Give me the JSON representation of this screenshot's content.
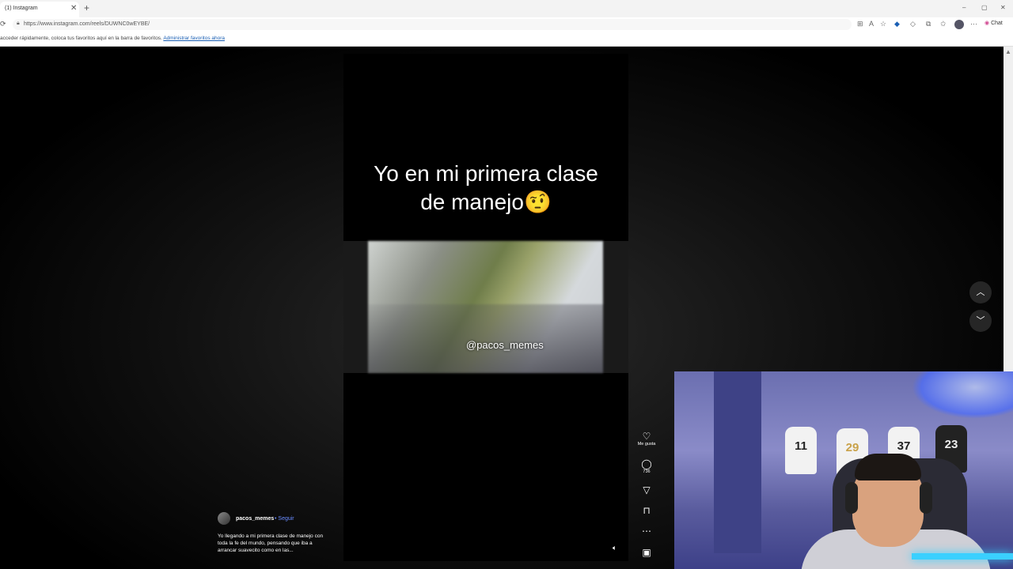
{
  "browser": {
    "tab_title": "(1) Instagram",
    "tab_close": "✕",
    "new_tab": "+",
    "url": "https://www.instagram.com/reels/DUWNC0wEYBE/",
    "copilot_label": "Chat",
    "favorites_text": "acceder rápidamente, coloca tus favoritos aquí en la barra de favoritos.",
    "favorites_link": "Administrar favoritos ahora",
    "window_controls": [
      "–",
      "▢",
      "✕"
    ]
  },
  "reel": {
    "caption_line1": "Yo en mi primera clase",
    "caption_line2": "de manejo🤨",
    "watermark": "@pacos_memes"
  },
  "actions": {
    "like_label": "Me gusta",
    "comment_count": "736"
  },
  "author": {
    "username": "pacos_memes",
    "follow_label": "• Seguir",
    "description": "Yo llegando a mi primera clase de manejo con toda la fe del mundo, pensando que iba a arrancar suavecito como en las..."
  },
  "icons": {
    "like": "heart-icon",
    "comment": "comment-icon",
    "share": "share-icon",
    "save": "bookmark-icon",
    "more": "more-icon",
    "audio": "audio-icon",
    "nav_up": "chevron-up-icon",
    "nav_down": "chevron-down-icon"
  },
  "jerseys": [
    "11",
    "29",
    "37",
    "23"
  ]
}
